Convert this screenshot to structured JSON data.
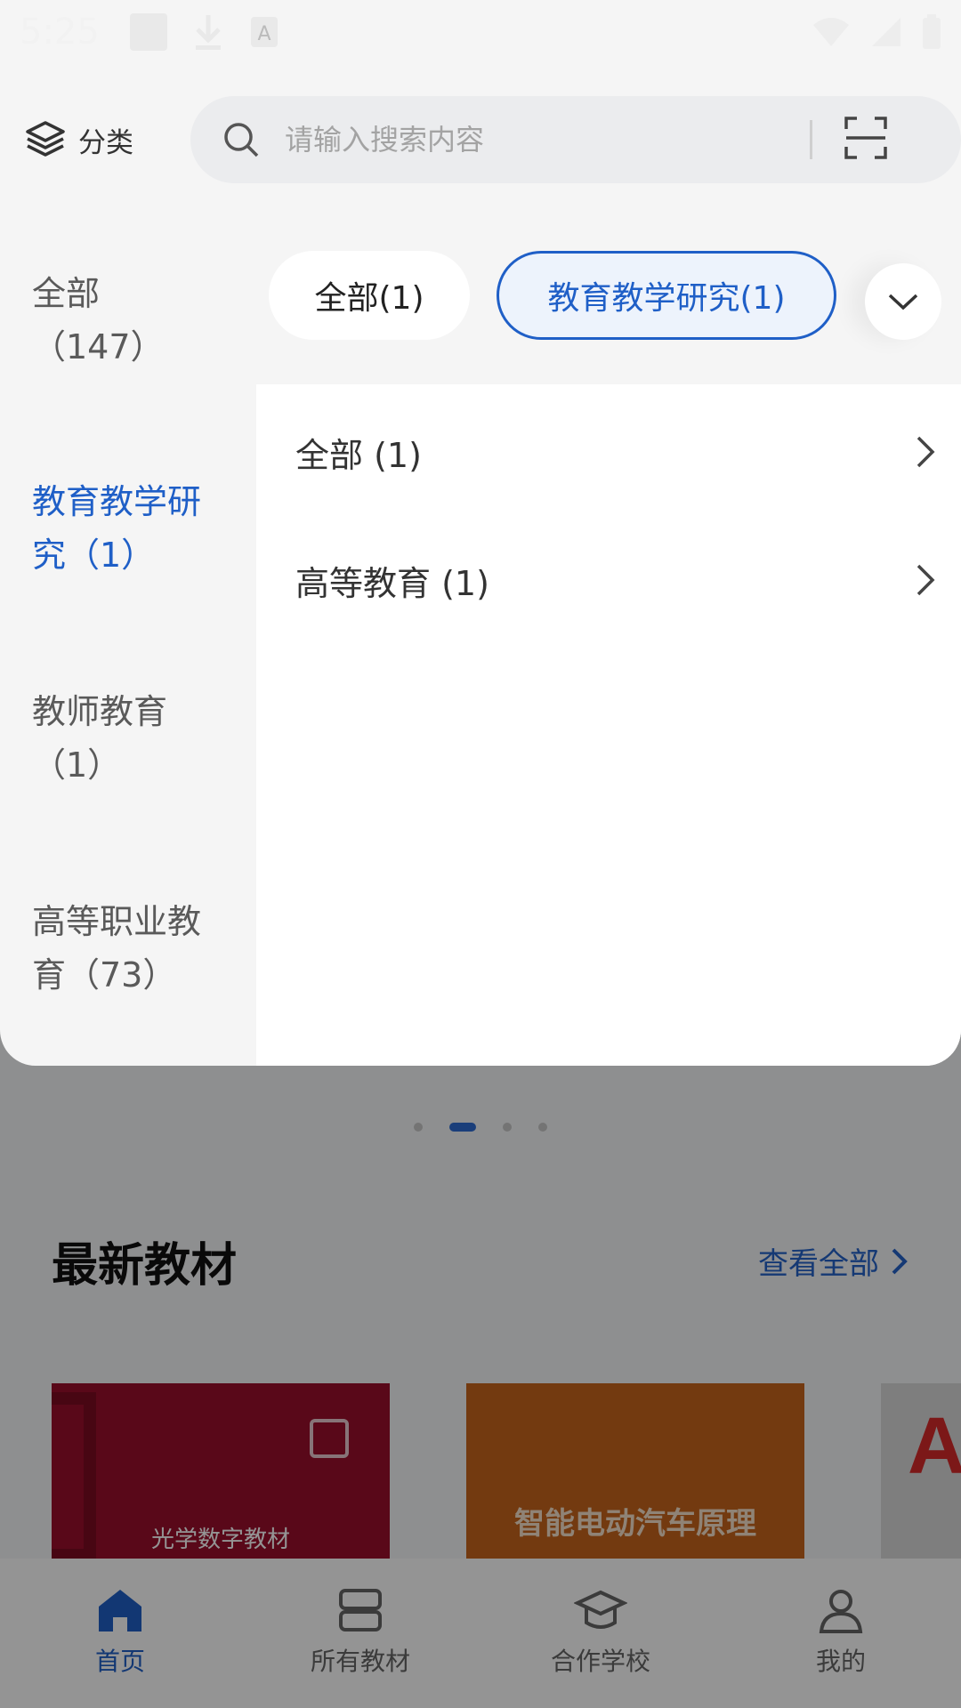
{
  "status_bar": {
    "time": "5:25"
  },
  "header": {
    "category_label": "分类",
    "search_placeholder": "请输入搜索内容"
  },
  "left_categories": [
    {
      "line1": "全部",
      "line2": "（147）"
    },
    {
      "line1": "教育教学研",
      "line2": "究（1）"
    },
    {
      "line1": "教师教育",
      "line2": "（1）"
    },
    {
      "line1": "高等职业教",
      "line2": "育（73）"
    }
  ],
  "chips": [
    {
      "label": "全部(1)"
    },
    {
      "label": "教育教学研究(1)"
    }
  ],
  "subcategories": [
    {
      "label": "全部 (1)"
    },
    {
      "label": "高等教育 (1)"
    }
  ],
  "latest": {
    "title": "最新教材",
    "see_all": "查看全部"
  },
  "books": [
    {
      "title": "光学数字教材"
    },
    {
      "title": "智能电动汽车原理"
    }
  ],
  "bottom_nav": [
    {
      "label": "首页"
    },
    {
      "label": "所有教材"
    },
    {
      "label": "合作学校"
    },
    {
      "label": "我的"
    }
  ],
  "colors": {
    "accent": "#1f5fc7",
    "panel_bg": "#f5f5f5"
  }
}
